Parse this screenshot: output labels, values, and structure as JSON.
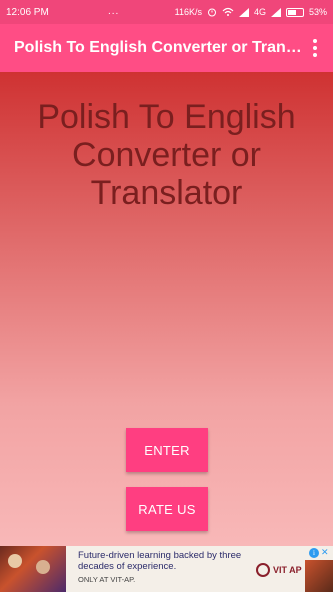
{
  "status_bar": {
    "time": "12:06 PM",
    "dots": "...",
    "network_speed": "116K/s",
    "network_type": "4G",
    "battery_percent": "53%",
    "icons": [
      "alarm-icon",
      "wifi-icon",
      "signal-icon",
      "signal-icon",
      "battery-icon"
    ]
  },
  "app_bar": {
    "title": "Polish To English Converter or Translator",
    "menu_icon": "overflow-menu-icon"
  },
  "main": {
    "headline": "Polish To English Converter or Translator",
    "enter_label": "ENTER",
    "rate_label": "RATE US"
  },
  "ad": {
    "headline": "Future-driven learning backed by three decades of experience.",
    "subtext": "ONLY AT VIT-AP.",
    "logo_text": "VIT AP",
    "info_label": "i",
    "close_label": "✕"
  },
  "colors": {
    "status_bar": "#f0467a",
    "app_bar": "#ff4d85",
    "button": "#ff3e81",
    "headline_text": "#7a1f1f",
    "gradient_top": "#cf3232",
    "gradient_bottom": "#f8b8b8"
  }
}
